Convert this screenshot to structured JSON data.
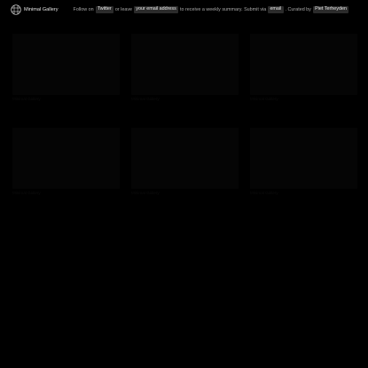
{
  "header": {
    "brand": "Minimal Gallery",
    "logo_icon": "grid-globe-icon",
    "follow_prefix": "Follow on",
    "twitter_label": "Twitter",
    "or_leave": "or leave",
    "email_placeholder": "your email address",
    "receive_text": "to receive a weekly summary. Submit via",
    "submit_email_label": "email",
    "curated_by": ". Curated by",
    "curator": "Piet Terheyden"
  },
  "colors": {
    "background": "#000000",
    "pill": "#2b2b2b"
  },
  "gallery": {
    "items": [
      {
        "label": "Minimal Gallery"
      },
      {
        "label": "Minimal Gallery"
      },
      {
        "label": "Minimal Gallery"
      },
      {
        "label": "Minimal Gallery"
      },
      {
        "label": "Minimal Gallery"
      },
      {
        "label": "Minimal Gallery"
      }
    ]
  }
}
